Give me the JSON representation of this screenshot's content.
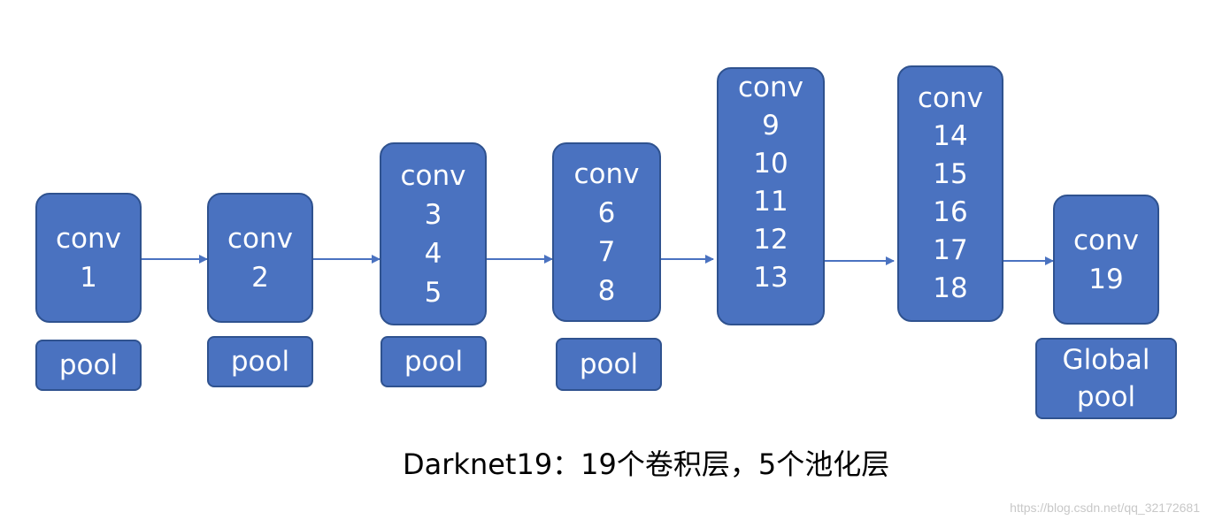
{
  "conv_blocks": [
    {
      "title": "conv",
      "layers": [
        "1"
      ]
    },
    {
      "title": "conv",
      "layers": [
        "2"
      ]
    },
    {
      "title": "conv",
      "layers": [
        "3",
        "4",
        "5"
      ]
    },
    {
      "title": "conv",
      "layers": [
        "6",
        "7",
        "8"
      ]
    },
    {
      "title": "conv",
      "layers": [
        "9",
        "10",
        "11",
        "12",
        "13"
      ]
    },
    {
      "title": "conv",
      "layers": [
        "14",
        "15",
        "16",
        "17",
        "18"
      ]
    },
    {
      "title": "conv",
      "layers": [
        "19"
      ]
    }
  ],
  "pool_blocks": [
    {
      "lines": [
        "pool"
      ]
    },
    {
      "lines": [
        "pool"
      ]
    },
    {
      "lines": [
        "pool"
      ]
    },
    {
      "lines": [
        "pool"
      ]
    },
    {
      "lines": [
        "Global",
        "pool"
      ]
    }
  ],
  "caption": "Darknet19：19个卷积层，5个池化层",
  "watermark": "https://blog.csdn.net/qq_32172681",
  "colors": {
    "block_fill": "#4a72c0",
    "block_border": "#2f528f",
    "arrow": "#4a72c0"
  }
}
